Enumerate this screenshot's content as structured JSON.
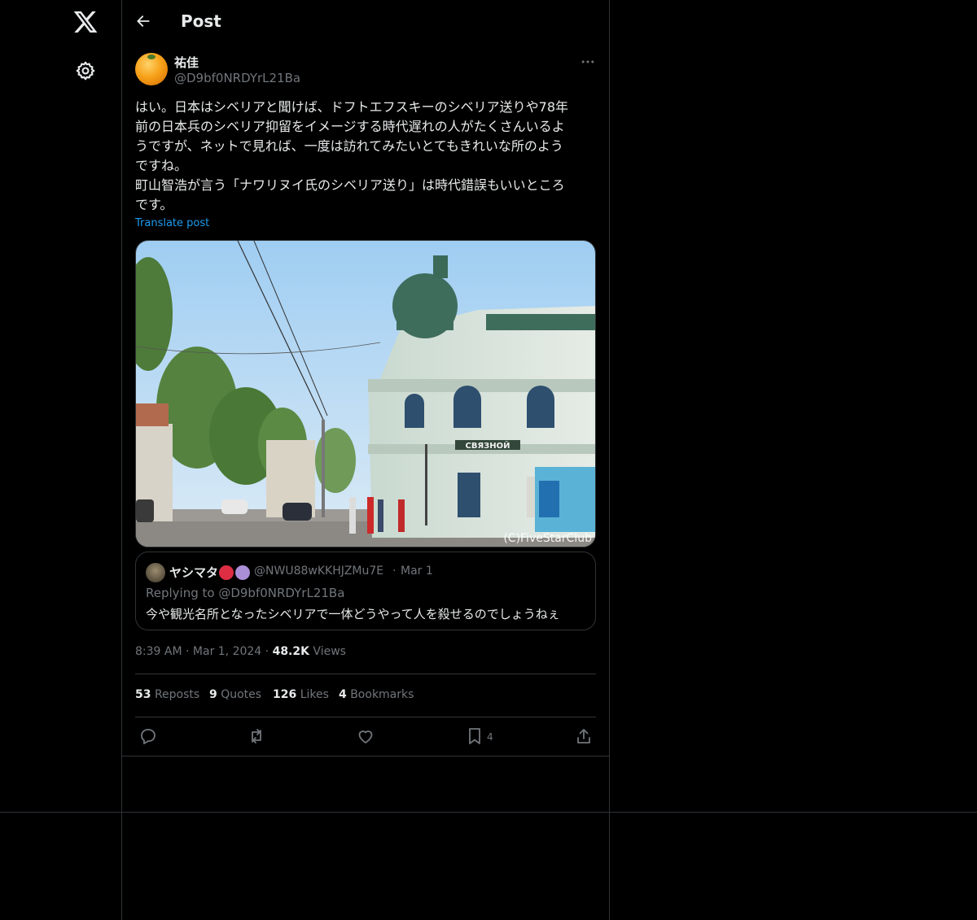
{
  "header": {
    "title": "Post"
  },
  "post": {
    "author_name": "祐佳",
    "author_handle": "@D9bf0NRDYrL21Ba",
    "text": "はい。日本はシベリアと聞けば、ドフトエフスキーのシベリア送りや78年\n前の日本兵のシベリア抑留をイメージする時代遅れの人がたくさんいるよ\nうですが、ネットで見れば、一度は訪れてみたいとてもきれいな所のよう\nですね。\n町山智浩が言う「ナワリヌイ氏のシベリア送り」は時代錯誤もいいところ\nです。",
    "translate_label": "Translate post",
    "photo_sign_text": "СВЯЗНОЙ",
    "photo_watermark": "(C)FiveStarClub",
    "time": "8:39 AM",
    "date": "Mar 1, 2024",
    "views_count": "48.2K",
    "views_label": "Views"
  },
  "quote": {
    "name": "ヤシマタ",
    "handle": "@NWU88wKKHJZMu7E",
    "separator": "·",
    "date": "Mar 1",
    "replying": "Replying to @D9bf0NRDYrL21Ba",
    "text": "今や観光名所となったシベリアで一体どうやって人を殺せるのでしょうねぇ"
  },
  "stats": {
    "reposts_count": "53",
    "reposts_label": "Reposts",
    "quotes_count": "9",
    "quotes_label": "Quotes",
    "likes_count": "126",
    "likes_label": "Likes",
    "bookmarks_count": "4",
    "bookmarks_label": "Bookmarks"
  },
  "actions": {
    "bookmark_count": "4"
  },
  "colors": {
    "accent": "#1d9bf0",
    "muted": "#71767b",
    "text": "#e7e9ea",
    "border": "#2f3336"
  },
  "icons": [
    "x-logo-icon",
    "gear-icon",
    "back-arrow-icon",
    "more-icon",
    "reply-icon",
    "repost-icon",
    "like-icon",
    "bookmark-icon",
    "share-icon"
  ]
}
